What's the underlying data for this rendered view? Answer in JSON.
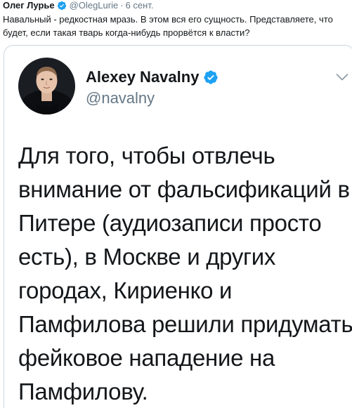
{
  "outer_tweet": {
    "name": "Олег Лурье",
    "handle": "@OlegLurie",
    "separator": "·",
    "date": "6 сент.",
    "text": "Навальный - редкостная мразь. В этом вся его сущность. Представляете, что будет, если такая тварь когда-нибудь прорвётся к власти?"
  },
  "quoted_tweet": {
    "name": "Alexey Navalny",
    "handle": "@navalny",
    "lines": [
      "Для того, чтобы отвлечь",
      "внимание от фальсификаций в",
      "Питере (аудиозаписи просто",
      "есть), в Москве и других",
      "городах, Кириенко и",
      "Памфилова решили придумать",
      "фейковое нападение на",
      "Памфилову."
    ]
  },
  "colors": {
    "verified": "#1da1f2",
    "secondary_text": "#657786",
    "border": "#ccd6dd"
  },
  "icons": {
    "verified": "verified-badge-icon",
    "menu": "chevron-down-icon"
  }
}
